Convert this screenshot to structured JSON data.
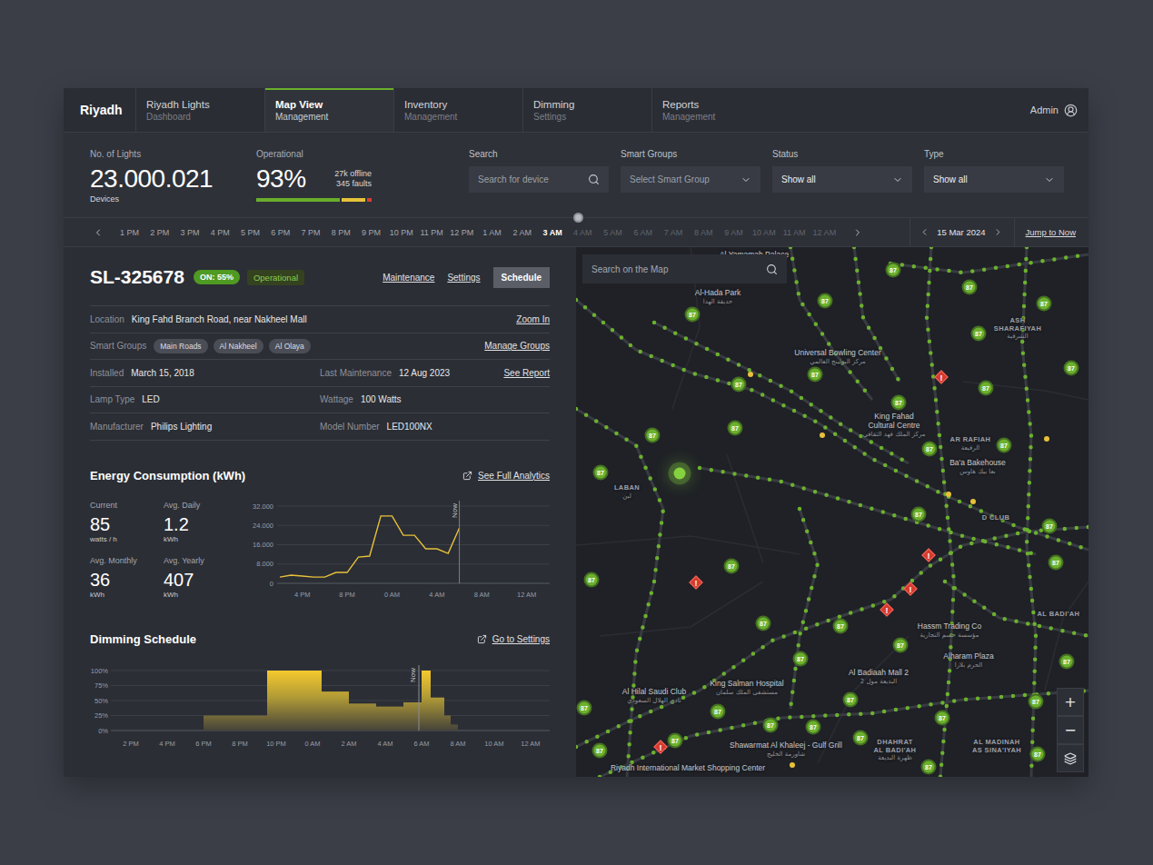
{
  "nav": {
    "brand": "Riyadh",
    "tabs": [
      {
        "title": "Riyadh Lights",
        "subtitle": "Dashboard",
        "selected": false
      },
      {
        "title": "Map View",
        "subtitle": "Management",
        "selected": true
      },
      {
        "title": "Inventory",
        "subtitle": "Management",
        "selected": false
      },
      {
        "title": "Dimming",
        "subtitle": "Settings",
        "selected": false
      },
      {
        "title": "Reports",
        "subtitle": "Management",
        "selected": false
      }
    ],
    "user": "Admin"
  },
  "stats": {
    "lights": {
      "label": "No. of Lights",
      "value": "23.000.021",
      "unit": "Devices"
    },
    "operational": {
      "label": "Operational",
      "value": "93%",
      "offline": "27k offline",
      "faults": "345 faults",
      "segments": [
        {
          "level": 0.73,
          "color": "#6aae2c"
        },
        {
          "level": 0.21,
          "color": "#e7c23a"
        },
        {
          "level": 0.04,
          "color": "#d6402f"
        }
      ]
    }
  },
  "filters": [
    {
      "label": "Search",
      "kind": "search",
      "value": "Search for device",
      "muted": true
    },
    {
      "label": "Smart Groups",
      "kind": "select",
      "value": "Select Smart Group",
      "muted": true
    },
    {
      "label": "Status",
      "kind": "select",
      "value": "Show all",
      "muted": false
    },
    {
      "label": "Type",
      "kind": "select",
      "value": "Show all",
      "muted": false
    }
  ],
  "timeline": {
    "level": 0.6386,
    "hours": [
      {
        "label": "1 PM",
        "selected": false,
        "future": false
      },
      {
        "label": "2 PM",
        "selected": false,
        "future": false
      },
      {
        "label": "3 PM",
        "selected": false,
        "future": false
      },
      {
        "label": "4 PM",
        "selected": false,
        "future": false
      },
      {
        "label": "5 PM",
        "selected": false,
        "future": false
      },
      {
        "label": "6 PM",
        "selected": false,
        "future": false
      },
      {
        "label": "7 PM",
        "selected": false,
        "future": false
      },
      {
        "label": "8 PM",
        "selected": false,
        "future": false
      },
      {
        "label": "9 PM",
        "selected": false,
        "future": false
      },
      {
        "label": "10 PM",
        "selected": false,
        "future": false
      },
      {
        "label": "11 PM",
        "selected": false,
        "future": false
      },
      {
        "label": "12 PM",
        "selected": false,
        "future": false
      },
      {
        "label": "1 AM",
        "selected": false,
        "future": false
      },
      {
        "label": "2 AM",
        "selected": false,
        "future": false
      },
      {
        "label": "3 AM",
        "selected": true,
        "future": false
      },
      {
        "label": "4 AM",
        "selected": false,
        "future": true
      },
      {
        "label": "5 AM",
        "selected": false,
        "future": true
      },
      {
        "label": "6 AM",
        "selected": false,
        "future": true
      },
      {
        "label": "7 AM",
        "selected": false,
        "future": true
      },
      {
        "label": "8 AM",
        "selected": false,
        "future": true
      },
      {
        "label": "9 AM",
        "selected": false,
        "future": true
      },
      {
        "label": "10 AM",
        "selected": false,
        "future": true
      },
      {
        "label": "11 AM",
        "selected": false,
        "future": true
      },
      {
        "label": "12 AM",
        "selected": false,
        "future": true
      }
    ],
    "date": "15 Mar 2024",
    "jump": "Jump to Now"
  },
  "device": {
    "id": "SL-325678",
    "badge": "ON: 55%",
    "status": "Operational",
    "actions": [
      {
        "label": "Maintenance",
        "selected": false
      },
      {
        "label": "Settings",
        "selected": false
      },
      {
        "label": "Schedule",
        "selected": true
      }
    ],
    "rows": [
      {
        "cells": [
          {
            "label": "Location",
            "value": "King Fahd Branch Road, near Nakheel Mall",
            "tags": []
          }
        ],
        "link": "Zoom In"
      },
      {
        "cells": [
          {
            "label": "Smart Groups",
            "value": "",
            "tags": [
              "Main Roads",
              "Al Nakheel",
              "Al Olaya"
            ]
          }
        ],
        "link": "Manage Groups"
      },
      {
        "cells": [
          {
            "label": "Installed",
            "value": "March 15, 2018",
            "tags": []
          },
          {
            "label": "Last Maintenance",
            "value": "12 Aug 2023",
            "tags": []
          }
        ],
        "link": "See Report"
      },
      {
        "cells": [
          {
            "label": "Lamp Type",
            "value": "LED",
            "tags": []
          },
          {
            "label": "Wattage",
            "value": "100 Watts",
            "tags": []
          }
        ],
        "link": ""
      },
      {
        "cells": [
          {
            "label": "Manufacturer",
            "value": "Philips Lighting",
            "tags": []
          },
          {
            "label": "Model Number",
            "value": "LED100NX",
            "tags": []
          }
        ],
        "link": ""
      }
    ]
  },
  "energy": {
    "title": "Energy Consumption (kWh)",
    "link": "See Full Analytics",
    "stats": [
      {
        "label": "Current",
        "value": "85",
        "unit": "watts / h"
      },
      {
        "label": "Avg. Daily",
        "value": "1.2",
        "unit": "kWh"
      },
      {
        "label": "Avg. Monthly",
        "value": "36",
        "unit": "kWh"
      },
      {
        "label": "Avg. Yearly",
        "value": "407",
        "unit": "kWh"
      }
    ],
    "chart": {
      "y_ticks": [
        "32.000",
        "24.000",
        "16.000",
        "8.000",
        "0"
      ],
      "x_ticks": [
        "4 PM",
        "8 PM",
        "0 AM",
        "4 AM",
        "8 AM",
        "12 AM"
      ],
      "now_label": "Now",
      "now_hour": 30,
      "start_hour": 14,
      "values": [
        2600,
        3400,
        3000,
        2600,
        2600,
        4500,
        4500,
        10900,
        11300,
        27900,
        27900,
        19900,
        19900,
        14300,
        14300,
        12400,
        23000
      ]
    }
  },
  "dimming": {
    "title": "Dimming Schedule",
    "link": "Go to Settings",
    "chart": {
      "y_ticks": [
        "100%",
        "75%",
        "50%",
        "25%",
        "0%"
      ],
      "x_ticks": [
        "2 PM",
        "4 PM",
        "6 PM",
        "8 PM",
        "10 PM",
        "0 AM",
        "2 AM",
        "4 AM",
        "6 AM",
        "8 AM",
        "10 AM",
        "12 AM"
      ],
      "now_label": "Now",
      "now_hour": 29.85,
      "bars": [
        {
          "from": 18,
          "to": 21.5,
          "level": 25
        },
        {
          "from": 21.5,
          "to": 24.5,
          "level": 100
        },
        {
          "from": 24.5,
          "to": 26,
          "level": 65
        },
        {
          "from": 26,
          "to": 27.5,
          "level": 45
        },
        {
          "from": 27.5,
          "to": 29,
          "level": 40
        },
        {
          "from": 29,
          "to": 30,
          "level": 47
        },
        {
          "from": 30,
          "to": 30.5,
          "level": 100
        },
        {
          "from": 30.5,
          "to": 31.25,
          "level": 55
        },
        {
          "from": 31.25,
          "to": 31.6,
          "level": 25
        },
        {
          "from": 31.6,
          "to": 32,
          "level": 10
        }
      ]
    }
  },
  "map": {
    "search_placeholder": "Search on the Map",
    "zoom_in": "+",
    "zoom_out": "−",
    "labels": [
      {
        "kind": "place",
        "text": [
          "Al Yamamah Palace"
        ],
        "arabic": ""
      },
      {
        "kind": "place",
        "text": [
          "Al-Hada Park"
        ],
        "arabic": "حديقة الهدا"
      },
      {
        "kind": "place",
        "text": [
          "Universal Bowling Center"
        ],
        "arabic": "مركز البولينج العالمي"
      },
      {
        "kind": "place",
        "text": [
          "King Fahad",
          "Cultural Centre"
        ],
        "arabic": "مركز الملك فهد الثقافي"
      },
      {
        "kind": "district",
        "text": [
          "ASH",
          "SHARAFIYAH"
        ],
        "arabic": "الشرفية"
      },
      {
        "kind": "district",
        "text": [
          "AR RAFIAH"
        ],
        "arabic": "الرفيعة"
      },
      {
        "kind": "place",
        "text": [
          "Ba'a Bakehouse"
        ],
        "arabic": "بعا بيك هاوس"
      },
      {
        "kind": "district",
        "text": [
          "D CLUB"
        ],
        "arabic": ""
      },
      {
        "kind": "district",
        "text": [
          "LABAN"
        ],
        "arabic": "لبن"
      },
      {
        "kind": "place",
        "text": [
          "Hassm Trading Co"
        ],
        "arabic": "مؤسسة حسم التجارية"
      },
      {
        "kind": "place",
        "text": [
          "Alharam Plaza"
        ],
        "arabic": "الحرم بلازا"
      },
      {
        "kind": "place",
        "text": [
          "Al Badiaah Mall 2"
        ],
        "arabic": "البديعة مول 2"
      },
      {
        "kind": "place",
        "text": [
          "King Salman Hospital"
        ],
        "arabic": "مستشفى الملك سلمان"
      },
      {
        "kind": "place",
        "text": [
          "Al Hilal Saudi Club"
        ],
        "arabic": "نادي الهلال السعودي"
      },
      {
        "kind": "place",
        "text": [
          "Shawarmat Al Khaleej - Gulf Grill"
        ],
        "arabic": "شاورمة الخليج"
      },
      {
        "kind": "place",
        "text": [
          "Riyadh International Market Shopping Center"
        ],
        "arabic": ""
      },
      {
        "kind": "district",
        "text": [
          "DHAHRAT",
          "AL BADI'AH"
        ],
        "arabic": "ظهرة البديعة"
      },
      {
        "kind": "district",
        "text": [
          "AL MADINAH",
          "AS SINA'IYAH"
        ],
        "arabic": ""
      },
      {
        "kind": "district",
        "text": [
          "AL BADI'AH"
        ],
        "arabic": ""
      }
    ],
    "clusters": [
      {
        "label": "87"
      },
      {
        "label": "87"
      },
      {
        "label": "87"
      },
      {
        "label": "87"
      },
      {
        "label": "87"
      },
      {
        "label": "87"
      },
      {
        "label": "87"
      },
      {
        "label": "87"
      },
      {
        "label": "87"
      },
      {
        "label": "87"
      },
      {
        "label": "87"
      },
      {
        "label": "87"
      },
      {
        "label": "87"
      },
      {
        "label": "87"
      },
      {
        "label": "87"
      },
      {
        "label": "87"
      },
      {
        "label": "87"
      },
      {
        "label": "87"
      },
      {
        "label": "87"
      },
      {
        "label": "87"
      },
      {
        "label": "87"
      },
      {
        "label": "87"
      },
      {
        "label": "87"
      },
      {
        "label": "87"
      },
      {
        "label": "87"
      },
      {
        "label": "87"
      },
      {
        "label": "87"
      },
      {
        "label": "87"
      },
      {
        "label": "87"
      },
      {
        "label": "87"
      },
      {
        "label": "87"
      },
      {
        "label": "87"
      },
      {
        "label": "87"
      },
      {
        "label": "87"
      },
      {
        "label": "87"
      },
      {
        "label": "87"
      },
      {
        "label": "87"
      },
      {
        "label": "87"
      }
    ],
    "markers": [
      {
        "kind": "selected",
        "label": "",
        "selected": true
      },
      {
        "kind": "fault",
        "label": "!",
        "selected": false
      },
      {
        "kind": "fault",
        "label": "!",
        "selected": false
      },
      {
        "kind": "fault",
        "label": "!",
        "selected": false
      },
      {
        "kind": "fault",
        "label": "!",
        "selected": false
      },
      {
        "kind": "fault",
        "label": "!",
        "selected": false
      },
      {
        "kind": "fault",
        "label": "!",
        "selected": false
      },
      {
        "kind": "warning",
        "label": "",
        "selected": false
      },
      {
        "kind": "warning",
        "label": "",
        "selected": false
      },
      {
        "kind": "warning",
        "label": "",
        "selected": false
      },
      {
        "kind": "warning",
        "label": "",
        "selected": false
      },
      {
        "kind": "warning",
        "label": "",
        "selected": false
      },
      {
        "kind": "warning",
        "label": "",
        "selected": false
      }
    ]
  }
}
